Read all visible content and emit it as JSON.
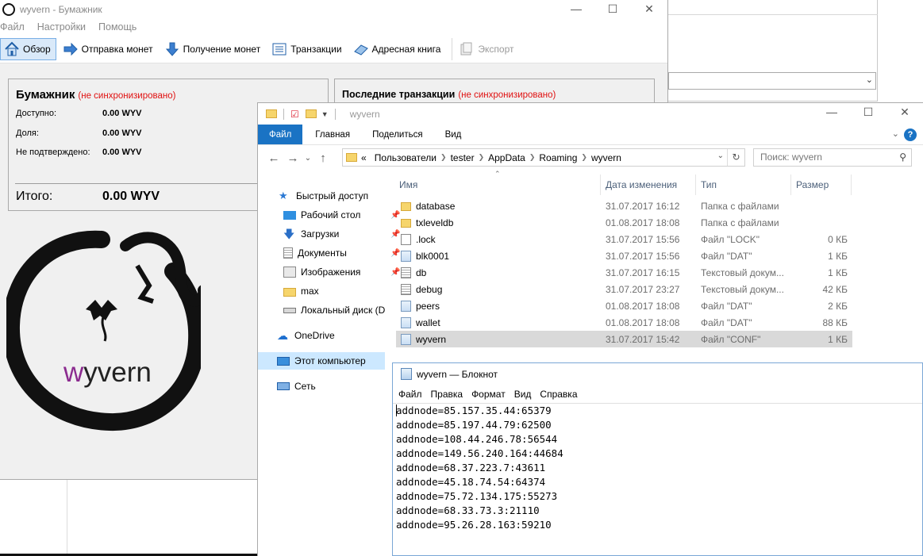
{
  "wallet": {
    "title": "wyvern - Бумажник",
    "menu": [
      "Файл",
      "Настройки",
      "Помощь"
    ],
    "toolbar": {
      "overview": "Обзор",
      "send": "Отправка монет",
      "receive": "Получение монет",
      "transactions": "Транзакции",
      "addressbook": "Адресная книга",
      "export": "Экспорт"
    },
    "balance": {
      "header": "Бумажник",
      "unsync": "(не синхронизировано)",
      "available_label": "Доступно:",
      "available_value": "0.00 WYV",
      "stake_label": "Доля:",
      "stake_value": "0.00 WYV",
      "unconfirmed_label": "Не подтверждено:",
      "unconfirmed_value": "0.00 WYV",
      "total_label": "Итого:",
      "total_value": "0.00 WYV"
    },
    "recent": {
      "header": "Последние транзакции",
      "unsync": "(не синхронизировано)"
    },
    "logo_text_accent": "w",
    "logo_text_rest": "yvern",
    "accent_color": "#8b2b8f",
    "unsync_color": "#e01010"
  },
  "explorer": {
    "title": "wyvern",
    "ribbon_tabs": [
      "Файл",
      "Главная",
      "Поделиться",
      "Вид"
    ],
    "address": {
      "prefix": "«",
      "crumbs": [
        "Пользователи",
        "tester",
        "AppData",
        "Roaming",
        "wyvern"
      ]
    },
    "search_placeholder": "Поиск: wyvern",
    "columns": [
      "Имя",
      "Дата изменения",
      "Тип",
      "Размер"
    ],
    "nav": [
      {
        "label": "Быстрый доступ",
        "icon": "star-icon",
        "pinned": false
      },
      {
        "label": "Рабочий стол",
        "icon": "desktop-icon",
        "pinned": true
      },
      {
        "label": "Загрузки",
        "icon": "download-icon",
        "pinned": true
      },
      {
        "label": "Документы",
        "icon": "documents-icon",
        "pinned": true
      },
      {
        "label": "Изображения",
        "icon": "pictures-icon",
        "pinned": true
      },
      {
        "label": "max",
        "icon": "folder-icon",
        "pinned": false
      },
      {
        "label": "Локальный диск (D",
        "icon": "drive-icon",
        "pinned": false
      },
      {
        "label": "OneDrive",
        "icon": "cloud-icon",
        "pinned": false
      },
      {
        "label": "Этот компьютер",
        "icon": "computer-icon",
        "pinned": false
      },
      {
        "label": "Сеть",
        "icon": "network-icon",
        "pinned": false
      }
    ],
    "files": [
      {
        "name": "database",
        "date": "31.07.2017 16:12",
        "type": "Папка с файлами",
        "size": "",
        "icon": "folder-icon"
      },
      {
        "name": "txleveldb",
        "date": "01.08.2017 18:08",
        "type": "Папка с файлами",
        "size": "",
        "icon": "folder-icon"
      },
      {
        "name": ".lock",
        "date": "31.07.2017 15:56",
        "type": "Файл \"LOCK\"",
        "size": "0 КБ",
        "icon": "file-icon"
      },
      {
        "name": "blk0001",
        "date": "31.07.2017 15:56",
        "type": "Файл \"DAT\"",
        "size": "1 КБ",
        "icon": "dat-file-icon"
      },
      {
        "name": "db",
        "date": "31.07.2017 16:15",
        "type": "Текстовый докум...",
        "size": "1 КБ",
        "icon": "text-file-icon"
      },
      {
        "name": "debug",
        "date": "31.07.2017 23:27",
        "type": "Текстовый докум...",
        "size": "42 КБ",
        "icon": "text-file-icon"
      },
      {
        "name": "peers",
        "date": "01.08.2017 18:08",
        "type": "Файл \"DAT\"",
        "size": "2 КБ",
        "icon": "dat-file-icon"
      },
      {
        "name": "wallet",
        "date": "01.08.2017 18:08",
        "type": "Файл \"DAT\"",
        "size": "88 КБ",
        "icon": "dat-file-icon"
      },
      {
        "name": "wyvern",
        "date": "31.07.2017 15:42",
        "type": "Файл \"CONF\"",
        "size": "1 КБ",
        "icon": "conf-file-icon",
        "selected": true
      }
    ]
  },
  "notepad": {
    "title": "wyvern — Блокнот",
    "menu": [
      "Файл",
      "Правка",
      "Формат",
      "Вид",
      "Справка"
    ],
    "lines": [
      "addnode=85.157.35.44:65379",
      "addnode=85.197.44.79:62500",
      "addnode=108.44.246.78:56544",
      "addnode=149.56.240.164:44684",
      "addnode=68.37.223.7:43611",
      "addnode=45.18.74.54:64374",
      "addnode=75.72.134.175:55273",
      "addnode=68.33.73.3:21110",
      "addnode=95.26.28.163:59210"
    ]
  }
}
